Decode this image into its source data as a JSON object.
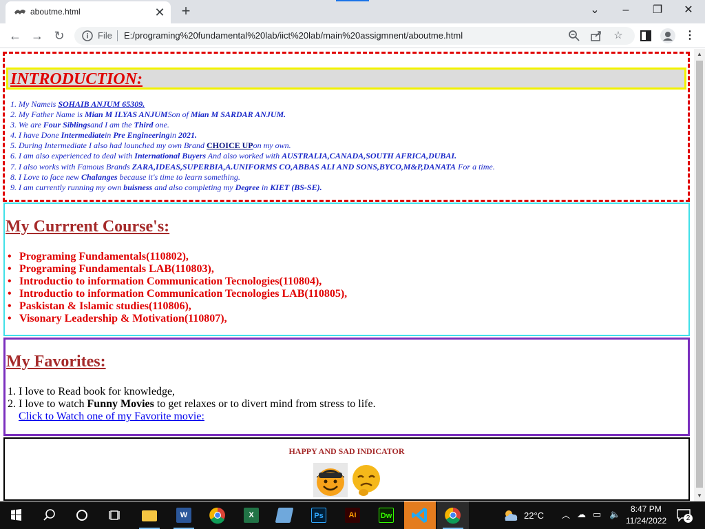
{
  "browser": {
    "tab_title": "aboutme.html",
    "tab_close": "✕",
    "new_tab": "+",
    "omnibox_file": "File",
    "url": "E:/programing%20fundamental%20lab/iict%20lab/main%20assigmnent/aboutme.html"
  },
  "intro": {
    "title": "INTRODUCTION:",
    "items": [
      {
        "n": "1. ",
        "a": "My Nameis ",
        "b": "SOHAIB ANJUM 65309."
      },
      {
        "n": "2. ",
        "a": "My Father Name is ",
        "b": "Mian M ILYAS ANJUM",
        "c": "Son of ",
        "d": "Mian M SARDAR ANJUM."
      },
      {
        "n": "3. ",
        "a": "We are ",
        "b": "Four Siblings",
        "c": "and I am the ",
        "d": "Third",
        "e": " one."
      },
      {
        "n": "4. ",
        "a": "I have Done ",
        "b": "Intermediate",
        "c": "in ",
        "d": "Pre Engineering",
        "e": "in ",
        "f": "2021."
      },
      {
        "n": "5. ",
        "a": "During Intermediate I also had lounched my own Brand ",
        "b": "CHOICE UP",
        "c": "on my own."
      },
      {
        "n": "6. ",
        "a": "I am also experienced to deal with ",
        "b": "International Buyers",
        "c": " And also worked with ",
        "d": "AUSTRALIA,CANADA,SOUTH AFRICA,DUBAI."
      },
      {
        "n": "7. ",
        "a": "I also works with Famous Brands ",
        "b": "ZARA,IDEAS,SUPERBIA,A.UNIFORMS CO,ABBAS ALI AND SONS,BYCO,M&P,DANATA",
        "c": " For a time."
      },
      {
        "n": "8. ",
        "a": "I Love to face new ",
        "b": "Chalanges",
        "c": " because it's time to learn something."
      },
      {
        "n": "9. ",
        "a": "I am currently running my own ",
        "b": "buisness",
        "c": " and also completing my ",
        "d": "Degree",
        "e": " in ",
        "f": "KIET (BS-SE)."
      }
    ]
  },
  "courses": {
    "title": "My Currrent Course's:",
    "items": [
      "Programing Fundamentals(110802),",
      "Programing Fundamentals LAB(110803),",
      "Introductio to information Communication Tecnologies(110804),",
      "Introductio to information Communication Tecnologies LAB(110805),",
      "Paskistan & Islamic studies(110806),",
      "Visonary Leadership & Motivation(110807),"
    ]
  },
  "favorites": {
    "title": "My Favorites:",
    "item1_num": "1.",
    "item1": "I love to Read book for knowledge,",
    "item2_num": "2.",
    "item2_a": "I love to watch ",
    "item2_b": "Funny Movies",
    "item2_c": " to get relaxes or to divert mind from stress to life.",
    "link": "Click to Watch one of my Favorite movie:"
  },
  "indicator": {
    "title": "HAPPY AND SAD INDICATOR"
  },
  "taskbar": {
    "temperature": "22°C",
    "time": "8:47 PM",
    "date": "11/24/2022",
    "notifications": "2",
    "apps": [
      "windows-start",
      "search",
      "cortana",
      "task-view",
      "file-explorer",
      "word",
      "chrome",
      "excel",
      "notepad",
      "photoshop",
      "illustrator",
      "dreamweaver",
      "vscode",
      "chrome-active"
    ]
  },
  "colors": {
    "intro_border": "#e00000",
    "intro_heading_border": "#f2f200",
    "intro_text": "#1a28c8",
    "course_border": "#40e0e8",
    "course_text": "#e00000",
    "section_title": "#a52a2a",
    "favorites_border": "#7b2fbe",
    "link": "#0000ee"
  }
}
